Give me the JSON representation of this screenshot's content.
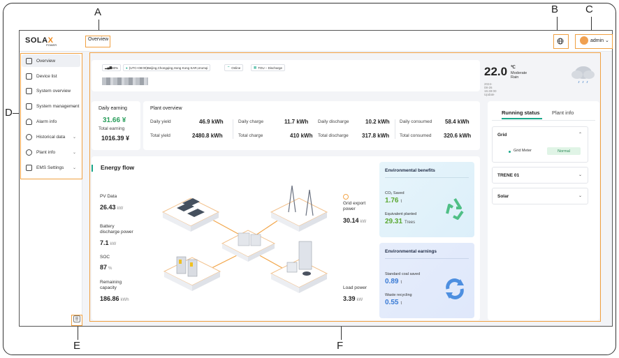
{
  "callouts": {
    "a": "A",
    "b": "B",
    "c": "C",
    "d": "D",
    "e": "E",
    "f": "F"
  },
  "header": {
    "logo_main": "SOLA",
    "logo_accent": "X",
    "logo_sub": "POWER",
    "breadcrumb": "Overview",
    "language_icon": "globe-icon",
    "user_name": "admin"
  },
  "sidebar": {
    "items": [
      {
        "label": "Overview",
        "icon": "dashboard-icon"
      },
      {
        "label": "Device list",
        "icon": "device-icon"
      },
      {
        "label": "System overview",
        "icon": "system-icon"
      },
      {
        "label": "System management",
        "icon": "management-icon",
        "chevron": "⌄"
      },
      {
        "label": "Alarm info",
        "icon": "alarm-icon"
      },
      {
        "label": "Historical data",
        "icon": "history-icon",
        "chevron": "⌄"
      },
      {
        "label": "Plant info",
        "icon": "plant-icon",
        "chevron": "⌄"
      },
      {
        "label": "EMS Settings",
        "icon": "ems-icon",
        "chevron": "⌄"
      }
    ],
    "collapse_icon": "collapse-menu-icon"
  },
  "status_bar": {
    "signal": "80%",
    "timezone": "(UTC+08:00)Beijing,Chongqing,Hong Kong SAR,Urumqi",
    "connection": "Online",
    "mode": "TOU – Discharge"
  },
  "weather": {
    "temperature": "22.0",
    "unit": "℃",
    "condition": "Moderate Rain",
    "updated": "2024-08-26 15:49:00 Update",
    "icon": "rain-cloud-icon"
  },
  "earning": {
    "daily_label": "Daily earning",
    "daily_value": "31.66 ¥",
    "total_label": "Total earning",
    "total_value": "1016.39 ¥"
  },
  "plant_overview": {
    "title": "Plant overview",
    "rows": [
      {
        "l1": "Daily yield",
        "v1": "46.9 kWh",
        "l2": "Daily charge",
        "v2": "11.7 kWh",
        "l3": "Daily discharge",
        "v3": "10.2 kWh",
        "l4": "Daily consumed",
        "v4": "58.4 kWh"
      },
      {
        "l1": "Total yield",
        "v1": "2480.8 kWh",
        "l2": "Total charge",
        "v2": "410 kWh",
        "l3": "Total discharge",
        "v3": "317.8 kWh",
        "l4": "Total consumed",
        "v4": "320.6 kWh"
      }
    ]
  },
  "energy_flow": {
    "title": "Energy flow",
    "pv_label": "PV Data",
    "pv_value": "26.43",
    "pv_unit": "kW",
    "battery_label_1": "Battery",
    "battery_label_2": "discharge power",
    "battery_value": "7.1",
    "battery_unit": "kW",
    "soc_label": "SOC",
    "soc_value": "87",
    "soc_unit": "%",
    "remaining_label_1": "Remaining",
    "remaining_label_2": "capacity",
    "remaining_value": "186.86",
    "remaining_unit": "kWh",
    "grid_label_1": "Grid export",
    "grid_label_2": "power",
    "grid_value": "30.14",
    "grid_unit": "kW",
    "load_label": "Load power",
    "load_value": "3.39",
    "load_unit": "kW"
  },
  "env_benefits": {
    "title": "Environmental benefits",
    "co2_label": "CO₂ Saved",
    "co2_value": "1.76",
    "co2_unit": "t",
    "trees_label": "Equivalent planted",
    "trees_value": "29.31",
    "trees_unit": "Trees",
    "icon": "recycle-icon"
  },
  "env_earnings": {
    "title": "Environmental earnings",
    "coal_label": "Standard coal saved",
    "coal_value": "0.89",
    "coal_unit": "t",
    "waste_label": "Waste recycling",
    "waste_value": "0.55",
    "waste_unit": "t",
    "icon": "refresh-icon"
  },
  "right_panel": {
    "tab_running": "Running status",
    "tab_plant": "Plant info",
    "grid_title": "Grid",
    "grid_meter": "Grid Meter",
    "grid_meter_status": "Normal",
    "section2": "TRENE 01",
    "section3": "Solar"
  },
  "colors": {
    "accent": "#f08a1d",
    "teal": "#1aa88a",
    "green": "#5aa832",
    "blue": "#3a7bd5"
  }
}
